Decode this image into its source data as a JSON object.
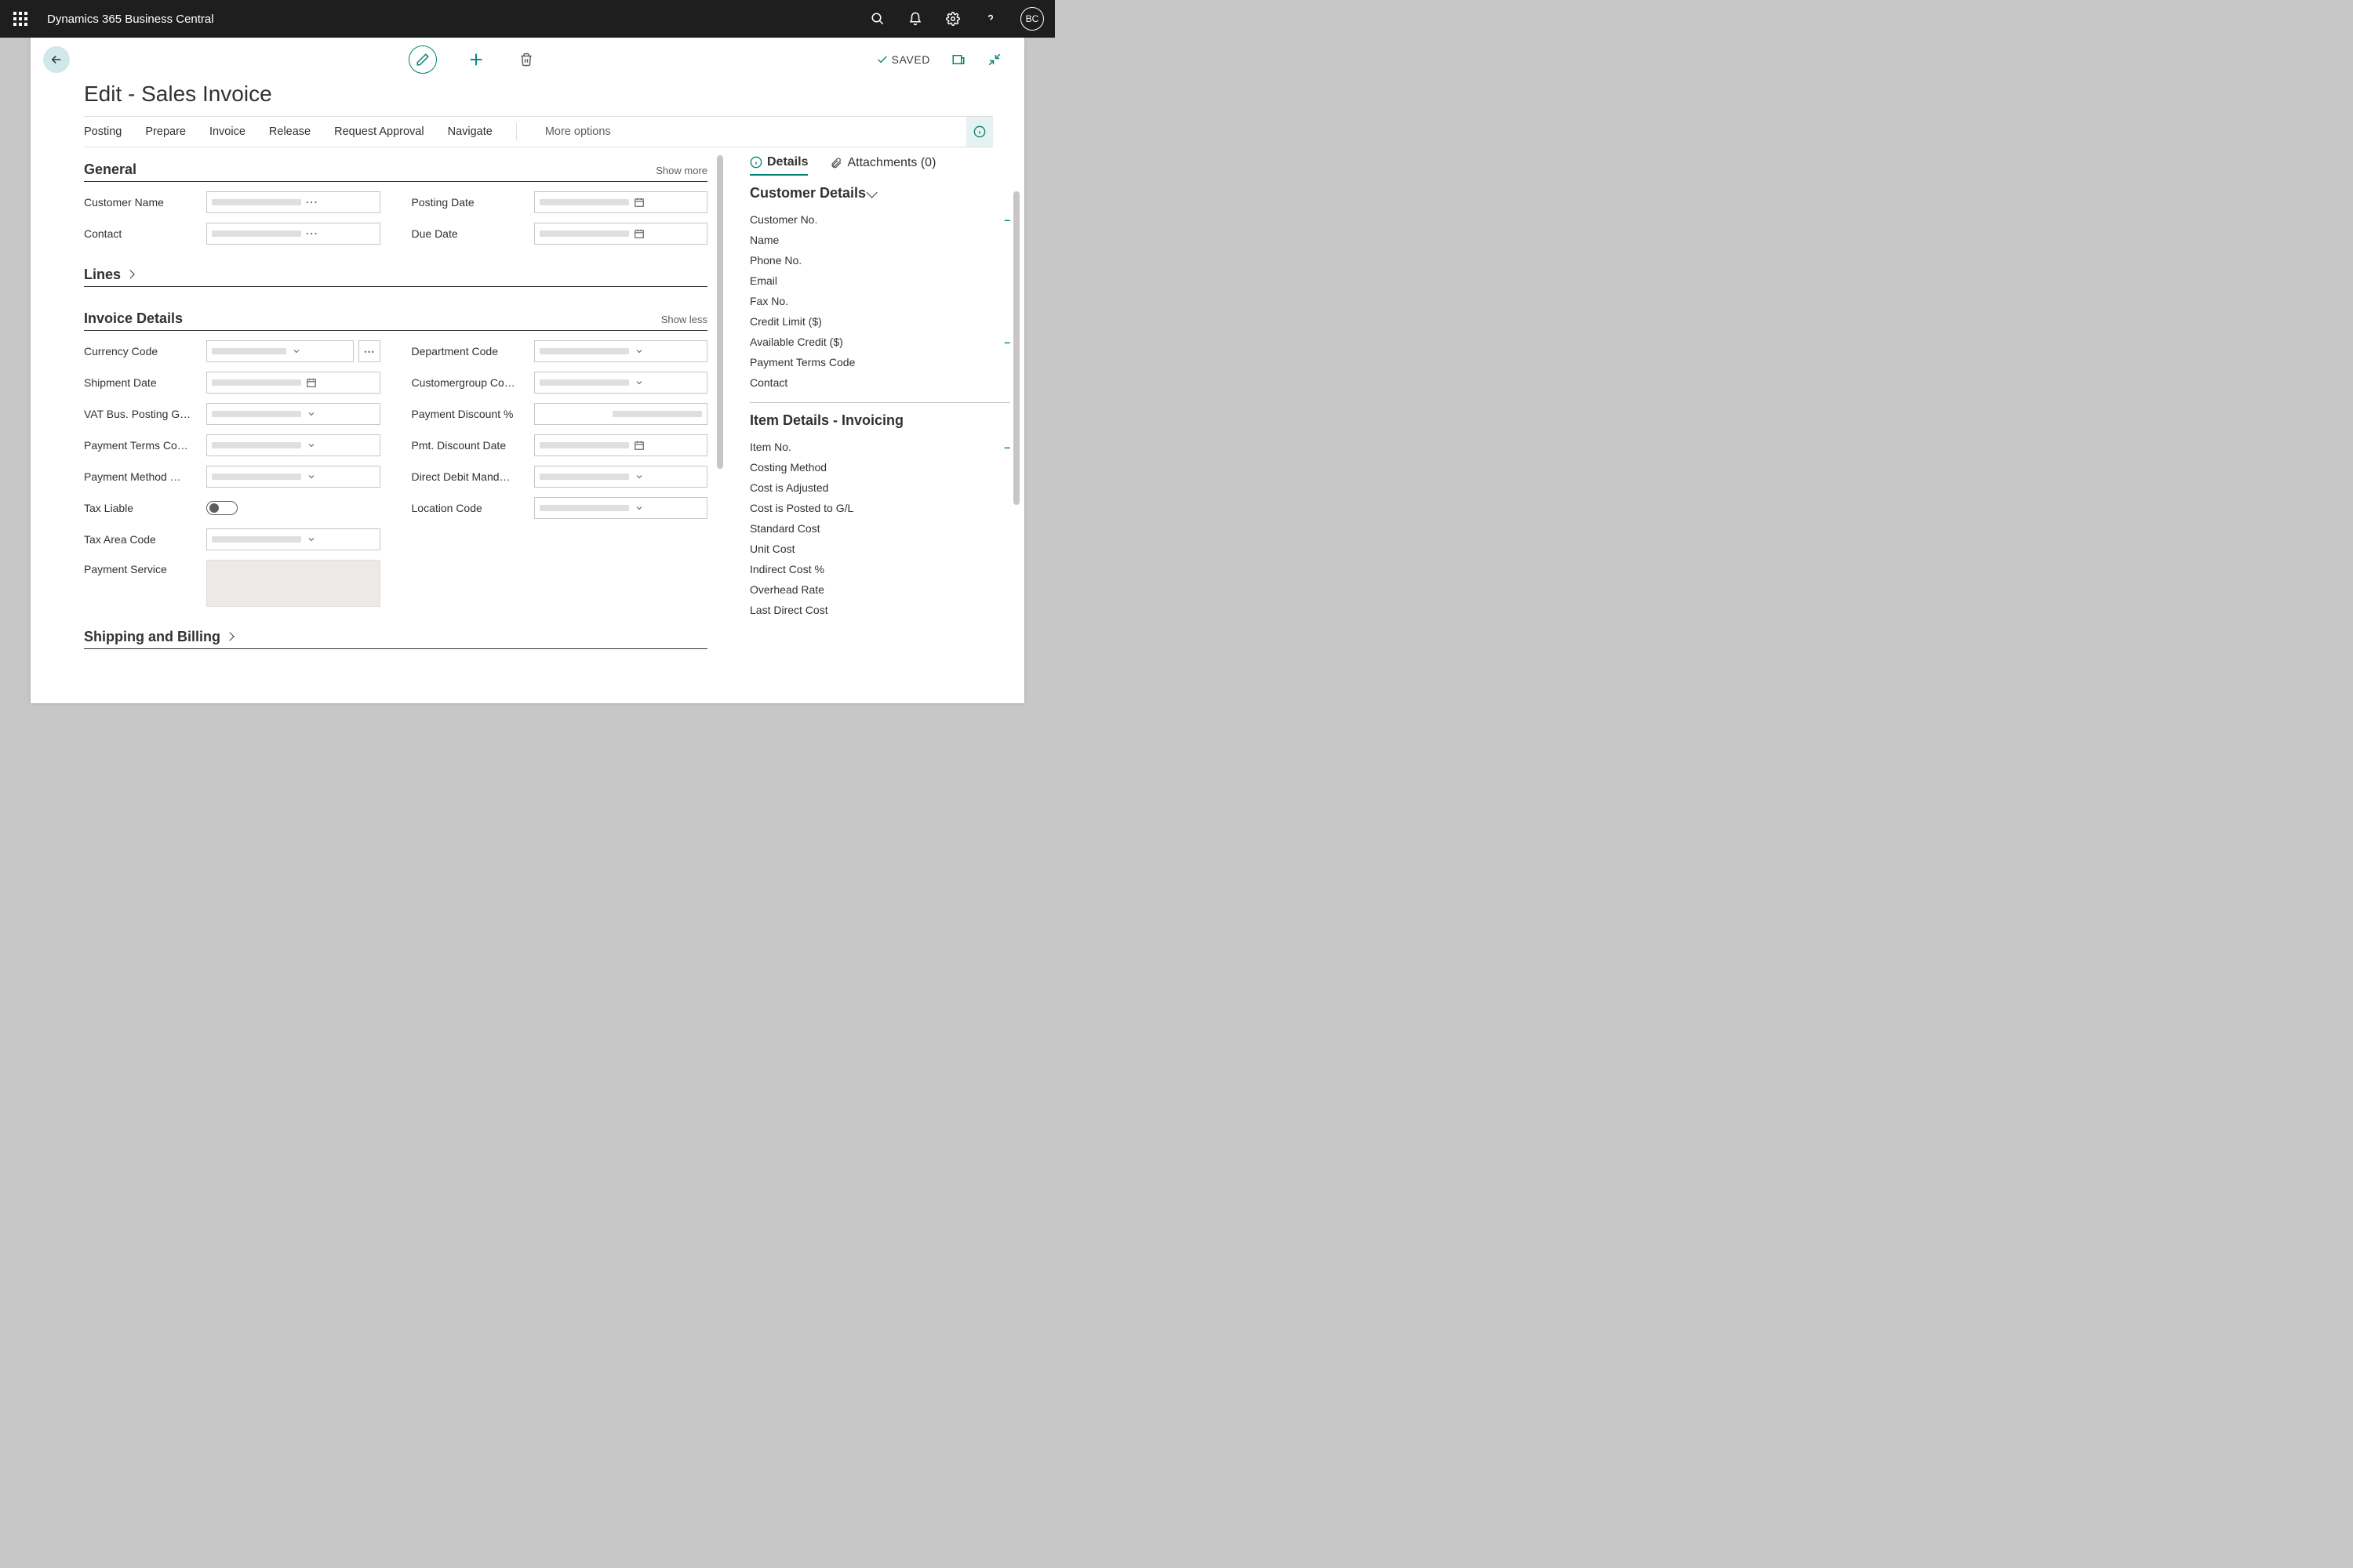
{
  "topbar": {
    "app_title": "Dynamics 365 Business Central",
    "avatar_initials": "BC"
  },
  "page": {
    "title": "Edit - Sales Invoice",
    "saved_label": "SAVED"
  },
  "actions": {
    "posting": "Posting",
    "prepare": "Prepare",
    "invoice": "Invoice",
    "release": "Release",
    "request_approval": "Request Approval",
    "navigate": "Navigate",
    "more_options": "More options"
  },
  "sections": {
    "general": {
      "title": "General",
      "toggle": "Show more"
    },
    "lines": {
      "title": "Lines"
    },
    "invoice_details": {
      "title": "Invoice Details",
      "toggle": "Show less"
    },
    "shipping_billing": {
      "title": "Shipping and Billing"
    }
  },
  "general_fields": {
    "customer_name": "Customer Name",
    "contact": "Contact",
    "posting_date": "Posting Date",
    "due_date": "Due Date"
  },
  "invoice_fields": {
    "currency_code": "Currency Code",
    "shipment_date": "Shipment Date",
    "vat_bus": "VAT Bus. Posting G…",
    "payment_terms": "Payment Terms Co…",
    "payment_method": "Payment Method …",
    "tax_liable": "Tax Liable",
    "tax_area": "Tax Area Code",
    "payment_service": "Payment Service",
    "department_code": "Department Code",
    "customergroup": "Customergroup Co…",
    "payment_discount": "Payment Discount %",
    "pmt_discount_date": "Pmt. Discount Date",
    "direct_debit": "Direct Debit Mand…",
    "location_code": "Location Code"
  },
  "factbox": {
    "details_tab": "Details",
    "attachments_tab": "Attachments (0)",
    "customer_details_title": "Customer Details",
    "customer_details": {
      "customer_no": "Customer No.",
      "name": "Name",
      "phone": "Phone No.",
      "email": "Email",
      "fax": "Fax No.",
      "credit_limit": "Credit Limit ($)",
      "available_credit": "Available Credit ($)",
      "payment_terms": "Payment Terms Code",
      "contact": "Contact"
    },
    "item_details_title": "Item Details - Invoicing",
    "item_details": {
      "item_no": "Item No.",
      "costing_method": "Costing Method",
      "cost_adjusted": "Cost is Adjusted",
      "cost_posted": "Cost is Posted to G/L",
      "standard_cost": "Standard Cost",
      "unit_cost": "Unit Cost",
      "indirect_cost": "Indirect Cost %",
      "overhead_rate": "Overhead Rate",
      "last_direct_cost": "Last Direct Cost"
    }
  }
}
